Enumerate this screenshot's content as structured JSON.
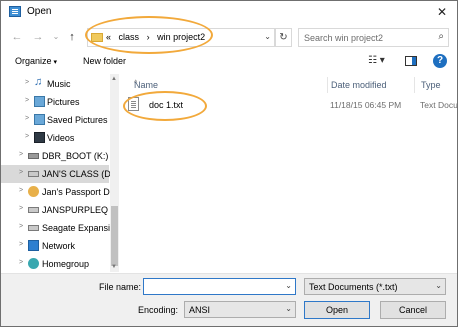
{
  "window": {
    "title": "Open",
    "close_glyph": "✕"
  },
  "nav_buttons": {
    "back": "←",
    "forward": "→",
    "recent": "⌄",
    "up": "↑"
  },
  "address": {
    "prefix": "«",
    "crumbs": [
      "class",
      "win project2"
    ],
    "separator": "›",
    "dropdown": "⌄",
    "refresh": "↻"
  },
  "search": {
    "placeholder": "Search win project2",
    "icon": "search-icon"
  },
  "toolbar": {
    "organize": "Organize",
    "new_folder": "New folder",
    "caret": "▾",
    "view_glyph": "☷ ▾",
    "help": "?"
  },
  "nav_items": [
    {
      "label": "Music",
      "icon": "music-icon"
    },
    {
      "label": "Pictures",
      "icon": "pictures-icon"
    },
    {
      "label": "Saved Pictures",
      "icon": "pictures-icon"
    },
    {
      "label": "Videos",
      "icon": "videos-icon"
    },
    {
      "label": "DBR_BOOT (K:)",
      "icon": "drive-icon"
    },
    {
      "label": "JAN'S CLASS (D:",
      "icon": "usb-drive-icon"
    },
    {
      "label": "Jan's Passport Dr",
      "icon": "person-icon"
    },
    {
      "label": "JANSPURPLEQ (L:)",
      "icon": "usb-drive-icon"
    },
    {
      "label": "Seagate Expansio",
      "icon": "usb-drive-icon"
    },
    {
      "label": "Network",
      "icon": "network-icon"
    },
    {
      "label": "Homegroup",
      "icon": "homegroup-icon"
    }
  ],
  "columns": {
    "name": "Name",
    "date": "Date modified",
    "type": "Type",
    "sort_glyph": "^"
  },
  "files": [
    {
      "name": "doc 1.txt",
      "date": "11/18/15 06:45 PM",
      "type": "Text Docu"
    }
  ],
  "bottom": {
    "file_name_label": "File name:",
    "file_name_value": "",
    "filter": "Text Documents (*.txt)",
    "encoding_label": "Encoding:",
    "encoding": "ANSI",
    "open": "Open",
    "cancel": "Cancel",
    "dropdown": "⌄"
  },
  "colors": {
    "accent": "#1e6fc0",
    "highlight_circle": "#f2a93b",
    "selected_nav": "#d9d9d9"
  }
}
